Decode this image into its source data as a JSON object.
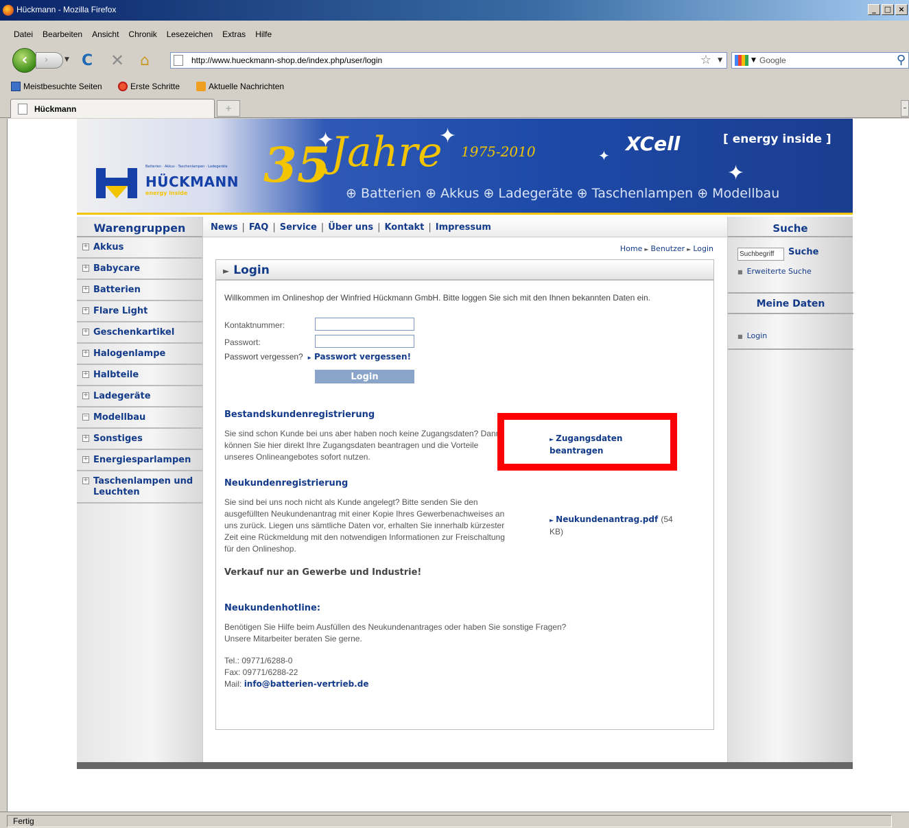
{
  "window": {
    "title": "Hückmann - Mozilla Firefox",
    "controls": [
      "_",
      "□",
      "×"
    ]
  },
  "menu": [
    "Datei",
    "Bearbeiten",
    "Ansicht",
    "Chronik",
    "Lesezeichen",
    "Extras",
    "Hilfe"
  ],
  "nav": {
    "url": "http://www.hueckmann-shop.de/index.php/user/login",
    "search_placeholder": "Google"
  },
  "bookmarks": [
    "Meistbesuchte Seiten",
    "Erste Schritte",
    "Aktuelle Nachrichten"
  ],
  "tab": {
    "label": "Hückmann"
  },
  "banner": {
    "tagline": "Batterien · Akkus · Taschenlampen · Ladegeräte",
    "brand": "HÜCKMANN",
    "brand_sub": "energy inside",
    "anniversary_number": "35",
    "anniversary_word": "Jahre",
    "years": "1975-2010",
    "xcell": "XCell",
    "energy": "[ energy inside ]",
    "categories": "⊕ Batterien   ⊕ Akkus   ⊕ Ladegeräte   ⊕ Taschenlampen   ⊕ Modellbau"
  },
  "left": {
    "heading": "Warengruppen",
    "items": [
      "Akkus",
      "Babycare",
      "Batterien",
      "Flare Light",
      "Geschenkartikel",
      "Halogenlampe",
      "Halbteile",
      "Ladegeräte",
      "Modellbau",
      "Sonstiges",
      "Energiesparlampen",
      "Taschenlampen und Leuchten"
    ]
  },
  "topnav": [
    "News",
    "FAQ",
    "Service",
    "Über uns",
    "Kontakt",
    "Impressum"
  ],
  "breadcrumb": [
    "Home",
    "Benutzer",
    "Login"
  ],
  "login": {
    "title": "Login",
    "intro": "Willkommen im Onlineshop der Winfried Hückmann GmbH. Bitte loggen Sie sich mit den Ihnen bekannten Daten ein.",
    "contact_label": "Kontaktnummer:",
    "password_label": "Passwort:",
    "forgot_text": "Passwort vergessen?",
    "forgot_link": "Passwort vergessen!",
    "button": "Login"
  },
  "existing": {
    "title": "Bestandskundenregistrierung",
    "lines": [
      "Sie sind schon Kunde bei uns aber haben noch keine Zugangsdaten? Dann",
      "können Sie hier direkt Ihre Zugangsdaten beantragen und die Vorteile",
      "unseres Onlineangebotes sofort nutzen."
    ],
    "link_line1": "Zugangsdaten",
    "link_line2": "beantragen"
  },
  "newcust": {
    "title": "Neukundenregistrierung",
    "lines": [
      "Sie sind bei uns noch nicht als Kunde angelegt? Bitte senden Sie den",
      "ausgefüllten Neukundenantrag mit einer Kopie Ihres Gewerbenachweises an",
      "uns zurück. Liegen uns sämtliche Daten vor, erhalten Sie innerhalb kürzester",
      "Zeit eine Rückmeldung mit den notwendigen Informationen zur Freischaltung",
      "für den Onlineshop."
    ],
    "pdf_link": "Neukundenantrag.pdf",
    "pdf_size_a": "(54",
    "pdf_size_b": "KB)",
    "notice": "Verkauf nur an Gewerbe und Industrie!"
  },
  "hotline": {
    "title": "Neukundenhotline:",
    "lines": [
      "Benötigen Sie Hilfe beim Ausfüllen des Neukundenantrages oder haben Sie sonstige Fragen?",
      "Unsere Mitarbeiter beraten Sie gerne."
    ],
    "tel": "Tel.: 09771/6288-0",
    "fax": "Fax: 09771/6288-22",
    "mail_label": "Mail:",
    "mail": "info@batterien-vertrieb.de"
  },
  "right": {
    "search_heading": "Suche",
    "search_placeholder": "Suchbegriff",
    "search_button": "Suche",
    "advanced": "Erweiterte Suche",
    "mydata_heading": "Meine Daten",
    "login_link": "Login"
  },
  "status": "Fertig",
  "colors": {
    "link": "#133b8a",
    "highlight": "#ff0000",
    "banner": "#1d4aa8",
    "gold": "#f2c500"
  }
}
